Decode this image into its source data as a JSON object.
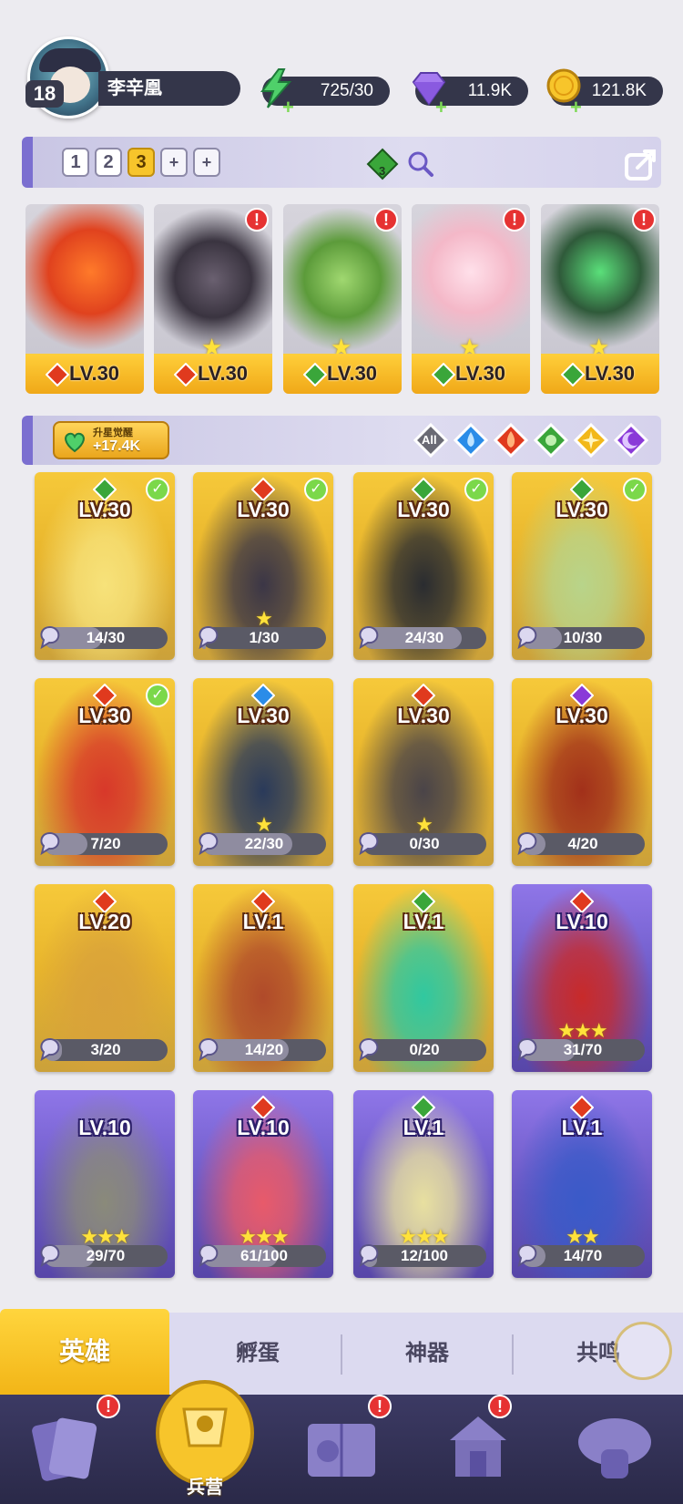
{
  "player": {
    "level": "18",
    "name": "李辛凰"
  },
  "resources": {
    "energy": "725/30",
    "gems": "11.9K",
    "coins": "121.8K"
  },
  "teams": {
    "tabs": [
      "1",
      "2",
      "3",
      "+",
      "+"
    ],
    "active_index": 2,
    "gem_badge": "3"
  },
  "formation": [
    {
      "level": "LV.30",
      "element": "fire",
      "alert": false,
      "star": false,
      "accent": "#e0421e"
    },
    {
      "level": "LV.30",
      "element": "fire",
      "alert": true,
      "star": true,
      "accent": "#3a3440"
    },
    {
      "level": "LV.30",
      "element": "wood",
      "alert": true,
      "star": true,
      "accent": "#5c9b3a"
    },
    {
      "level": "LV.30",
      "element": "wood",
      "alert": true,
      "star": true,
      "accent": "#f4b8c8"
    },
    {
      "level": "LV.30",
      "element": "wood",
      "alert": true,
      "star": true,
      "accent": "#2f5a3a"
    }
  ],
  "filter": {
    "awaken_label": "升星觉醒",
    "awaken_value": "+17.4K",
    "elements": [
      "All",
      "water",
      "fire",
      "wood",
      "light",
      "dark"
    ]
  },
  "heroes": [
    {
      "level": "LV.30",
      "element": "wood",
      "check": true,
      "frag": "14/30",
      "progress": 0.47,
      "stars": 0,
      "frame": "gold",
      "accent": "#f7e27a"
    },
    {
      "level": "LV.30",
      "element": "fire",
      "check": true,
      "frag": "1/30",
      "progress": 0.03,
      "stars": 1,
      "frame": "gold",
      "accent": "#3b3646"
    },
    {
      "level": "LV.30",
      "element": "wood",
      "check": true,
      "frag": "24/30",
      "progress": 0.8,
      "stars": 0,
      "frame": "gold",
      "accent": "#2a2c30"
    },
    {
      "level": "LV.30",
      "element": "wood",
      "check": true,
      "frag": "10/30",
      "progress": 0.33,
      "stars": 0,
      "frame": "gold",
      "accent": "#b8d48a"
    },
    {
      "level": "LV.30",
      "element": "fire",
      "check": true,
      "frag": "7/20",
      "progress": 0.35,
      "stars": 0,
      "frame": "gold",
      "accent": "#d8382a"
    },
    {
      "level": "LV.30",
      "element": "water",
      "check": false,
      "frag": "22/30",
      "progress": 0.73,
      "stars": 1,
      "frame": "gold",
      "accent": "#2a3a5a"
    },
    {
      "level": "LV.30",
      "element": "fire",
      "check": false,
      "frag": "0/30",
      "progress": 0,
      "stars": 1,
      "frame": "gold",
      "accent": "#4a4448"
    },
    {
      "level": "LV.30",
      "element": "dark",
      "check": false,
      "frag": "4/20",
      "progress": 0.2,
      "stars": 0,
      "frame": "gold",
      "accent": "#a2301a"
    },
    {
      "level": "LV.20",
      "element": "fire",
      "check": false,
      "frag": "3/20",
      "progress": 0.15,
      "stars": 0,
      "frame": "gold",
      "accent": "#d9a23a"
    },
    {
      "level": "LV.1",
      "element": "fire",
      "check": false,
      "frag": "14/20",
      "progress": 0.7,
      "stars": 0,
      "frame": "gold",
      "accent": "#b04a2a"
    },
    {
      "level": "LV.1",
      "element": "wood",
      "check": false,
      "frag": "0/20",
      "progress": 0,
      "stars": 0,
      "frame": "gold",
      "accent": "#30c8a0"
    },
    {
      "level": "LV.10",
      "element": "fire",
      "check": false,
      "frag": "31/70",
      "progress": 0.44,
      "stars": 3,
      "frame": "purple",
      "accent": "#c82a2a"
    },
    {
      "level": "LV.10",
      "element": "",
      "check": false,
      "frag": "29/70",
      "progress": 0.41,
      "stars": 3,
      "frame": "purple",
      "accent": "#8a8a7a"
    },
    {
      "level": "LV.10",
      "element": "fire",
      "check": false,
      "frag": "61/100",
      "progress": 0.61,
      "stars": 3,
      "frame": "purple",
      "accent": "#e85a6a"
    },
    {
      "level": "LV.1",
      "element": "wood",
      "check": false,
      "frag": "12/100",
      "progress": 0.12,
      "stars": 3,
      "frame": "purple",
      "accent": "#e8e0a0"
    },
    {
      "level": "LV.1",
      "element": "fire",
      "check": false,
      "frag": "14/70",
      "progress": 0.2,
      "stars": 2,
      "frame": "purple",
      "accent": "#3a5ac8"
    }
  ],
  "subtabs": {
    "heroes": "英雄",
    "eggs": "孵蛋",
    "artifacts": "神器",
    "resonance": "共鸣"
  },
  "nav": {
    "barracks": "兵营"
  },
  "colors": {
    "fire": "#e03a1e",
    "wood": "#3aa63a",
    "water": "#2a8ce8",
    "light": "#f2b81a",
    "dark": "#8a3ad8"
  }
}
